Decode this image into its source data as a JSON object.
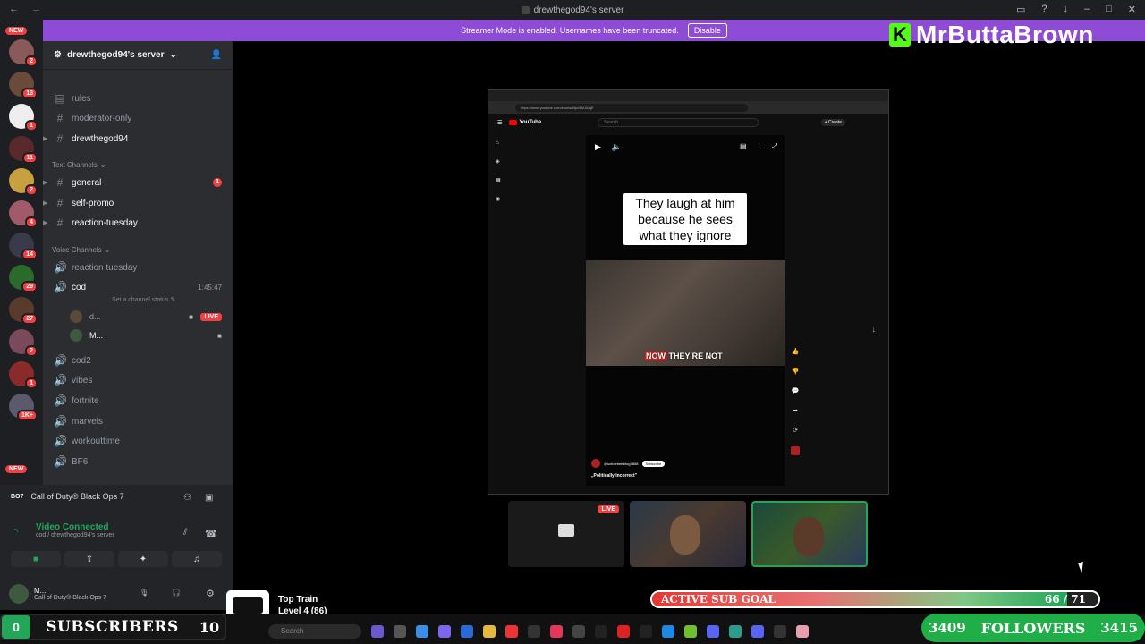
{
  "window": {
    "title": "drewthegod94's server"
  },
  "streamer_mode": {
    "message": "Streamer Mode is enabled. Usernames have been truncated.",
    "button_label": "Disable"
  },
  "brand": {
    "name": "MrButtaBrown",
    "logo_letter": "K"
  },
  "guild_rail": {
    "badges": [
      "2",
      "13",
      "1",
      "11",
      "2",
      "4",
      "14",
      "29",
      "27",
      "2",
      "1",
      "1K+"
    ],
    "new_labels": [
      "NEW",
      "NEW"
    ]
  },
  "server": {
    "name": "drewthegod94's server",
    "top_channels": [
      "rules",
      "moderator-only",
      "drewthegod94"
    ],
    "text_category": "Text Channels",
    "text_channels": [
      {
        "name": "general",
        "unread": "1"
      },
      {
        "name": "self-promo"
      },
      {
        "name": "reaction-tuesday"
      }
    ],
    "voice_category": "Voice Channels",
    "voice_channels": [
      "reaction tuesday",
      "cod",
      "cod2",
      "vibes",
      "fortnite",
      "marvels",
      "workouttime",
      "BF6"
    ],
    "active_voice": {
      "name": "cod",
      "timer": "1:45:47",
      "status": "Set a channel status",
      "users": [
        {
          "name": "d...",
          "badge": "LIVE"
        },
        {
          "name": "M..."
        }
      ]
    }
  },
  "panel": {
    "activity": "Call of Duty® Black Ops 7",
    "activity_logo": "BO7",
    "voice_status": "Video Connected",
    "voice_location": "cod / drewthegod94's server",
    "user_name": "M...",
    "user_activity": "Call of Duty® Black Ops 7"
  },
  "youtube": {
    "url": "https://www.youtube.com/shorts/f4pv5AUiUqE",
    "search_placeholder": "Search",
    "create_label": "+ Create",
    "caption": "They laugh at him because he sees what they ignore",
    "subtitle_highlight": "NOW",
    "subtitle_rest": "THEY'RE NOT",
    "channel_handle": "@schoebelsblog7868",
    "subscribe_label": "Subscribe",
    "short_title": "„Politically Incorrect\""
  },
  "streams": {
    "live_label": "LIVE"
  },
  "overlay": {
    "subscribers_label": "SUBSCRIBERS",
    "subscribers_left": "0",
    "subscribers_right": "10",
    "followers_left": "3409",
    "followers_label": "FOLLOWERS",
    "followers_right": "3415",
    "sub_goal_label": "ACTIVE SUB GOAL",
    "sub_goal_count": "66 / 71",
    "sub_goal_progress": 0.93,
    "top_train_title": "Top Train",
    "top_train_level": "Level 4 (86)"
  },
  "taskbar": {
    "search_placeholder": "Search"
  },
  "colors": {
    "streamer_bar": "#8e4bd6",
    "followers_green": "#1fae47",
    "live_red": "#f23f42"
  }
}
